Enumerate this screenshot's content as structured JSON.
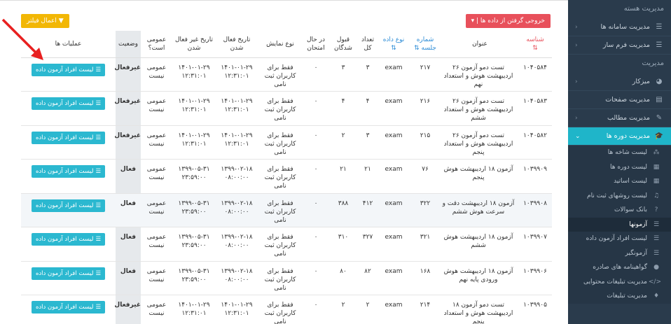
{
  "sidebar": {
    "section1": "مدیریت هسته",
    "items1": [
      {
        "label": "مدیریت سامانه ها",
        "icon": "☰"
      },
      {
        "label": "مدیریت فرم ساز",
        "icon": "☰"
      }
    ],
    "section2": "مدیریت",
    "items2": [
      {
        "label": "میزکار",
        "icon": "◕"
      },
      {
        "label": "مدیریت صفحات",
        "icon": "▤"
      },
      {
        "label": "مدیریت مطالب",
        "icon": "✎"
      },
      {
        "label": "مدیریت دوره ها",
        "icon": "🎓"
      }
    ],
    "sub": [
      {
        "label": "لیست شاخه ها",
        "icon": "⁂"
      },
      {
        "label": "لیست دوره ها",
        "icon": "▦"
      },
      {
        "label": "لیست اساتید",
        "icon": "▦"
      },
      {
        "label": "لیست روشهای ثبت نام",
        "icon": "♫"
      },
      {
        "label": "بانک سوالات",
        "icon": "?"
      },
      {
        "label": "آزمونها",
        "icon": "☰"
      },
      {
        "label": "لیست افراد آزمون داده",
        "icon": "☰"
      },
      {
        "label": "آزمونگیر",
        "icon": "☰"
      },
      {
        "label": "گواهینامه های صادره",
        "icon": "●"
      },
      {
        "label": "مدیریت تبلیغات محتوایی",
        "icon": "</>"
      },
      {
        "label": "مدیریت تبلیغات",
        "icon": "♦"
      }
    ]
  },
  "toolbar": {
    "export_label": "خروجی گرفتن از داده ها | ▾",
    "filter_label": "▼ اعمال فیلتر"
  },
  "table": {
    "headers": {
      "id": "شناسه",
      "title": "عنوان",
      "session": "شماره جلسه",
      "type": "نوع داده",
      "total": "تعداد کل",
      "accepted": "قبول شدگان",
      "exam": "در حال امتحان",
      "display": "نوع نمایش",
      "active_date": "تاریخ فعال شدن",
      "inactive_date": "تاریخ غیر فعال شدن",
      "public": "عمومی است؟",
      "status": "وضعیت",
      "ops": "عملیات ها"
    },
    "button_label": "لیست افراد آزمون داده",
    "rows": [
      {
        "id": "۱۰۴۰۵۸۴",
        "title": "تست دمو آزمون ۲۶ اردیبهشت هوش و استعداد نهم",
        "session": "۲۱۷",
        "type": "exam",
        "total": "۳",
        "accepted": "۳",
        "exam": "۰",
        "display": "فقط برای کاربران ثبت نامی",
        "active": "۱۴۰۱-۰۱-۲۹ ۱۲:۳۱:۰۱",
        "inactive": "۱۴۰۱-۰۱-۲۹ ۱۲:۳۱:۰۱",
        "public": "عمومی نیست",
        "status": "غیرفعال"
      },
      {
        "id": "۱۰۴۰۵۸۳",
        "title": "تست دمو آزمون ۲۶ اردیبهشت هوش و استعداد ششم",
        "session": "۲۱۶",
        "type": "exam",
        "total": "۴",
        "accepted": "۴",
        "exam": "۰",
        "display": "فقط برای کاربران ثبت نامی",
        "active": "۱۴۰۱-۰۱-۲۹ ۱۲:۳۱:۰۱",
        "inactive": "۱۴۰۱-۰۱-۲۹ ۱۲:۳۱:۰۱",
        "public": "عمومی نیست",
        "status": "غیرفعال"
      },
      {
        "id": "۱۰۴۰۵۸۲",
        "title": "تست دمو آزمون ۲۶ اردیبهشت هوش و استعداد پنجم",
        "session": "۲۱۵",
        "type": "exam",
        "total": "۳",
        "accepted": "۲",
        "exam": "۰",
        "display": "فقط برای کاربران ثبت نامی",
        "active": "۱۴۰۱-۰۱-۲۹ ۱۲:۳۱:۰۱",
        "inactive": "۱۴۰۱-۰۱-۲۹ ۱۲:۳۱:۰۱",
        "public": "عمومی نیست",
        "status": "غیرفعال"
      },
      {
        "id": "۱۰۳۹۹۰۹",
        "title": "آزمون ۱۸ اردیبهشت هوش پنجم",
        "session": "۷۶",
        "type": "exam",
        "total": "۲۱",
        "accepted": "۲۱",
        "exam": "۰",
        "display": "فقط برای کاربران ثبت نامی",
        "active": "۱۳۹۹-۰۲-۱۸ ۰۸:۰۰:۰۰",
        "inactive": "۱۳۹۹-۰۵-۳۱ ۲۳:۵۹:۰۰",
        "public": "عمومی نیست",
        "status": "فعال"
      },
      {
        "id": "۱۰۳۹۹۰۸",
        "title": "آزمون ۱۸ اردیبهشت دقت و سرعت هوش ششم",
        "session": "۳۲۲",
        "type": "exam",
        "total": "۴۱۲",
        "accepted": "۳۸۸",
        "exam": "۰",
        "display": "فقط برای کاربران ثبت نامی",
        "active": "۱۳۹۹-۰۲-۱۸ ۰۸:۰۰:۰۰",
        "inactive": "۱۳۹۹-۰۵-۳۱ ۲۳:۵۹:۰۰",
        "public": "عمومی نیست",
        "status": "فعال"
      },
      {
        "id": "۱۰۳۹۹۰۷",
        "title": "آزمون ۱۸ اردیبهشت هوش ششم",
        "session": "۳۲۱",
        "type": "exam",
        "total": "۳۲۷",
        "accepted": "۳۱۰",
        "exam": "۰",
        "display": "فقط برای کاربران ثبت نامی",
        "active": "۱۳۹۹-۰۲-۱۸ ۰۸:۰۰:۰۰",
        "inactive": "۱۳۹۹-۰۵-۳۱ ۲۳:۵۹:۰۰",
        "public": "عمومی نیست",
        "status": "فعال"
      },
      {
        "id": "۱۰۳۹۹۰۶",
        "title": "آزمون ۱۸ اردیبهشت هوش ورودی پایه نهم",
        "session": "۱۶۸",
        "type": "exam",
        "total": "۸۲",
        "accepted": "۸۰",
        "exam": "۰",
        "display": "فقط برای کاربران ثبت نامی",
        "active": "۱۳۹۹-۰۲-۱۸ ۰۸:۰۰:۰۰",
        "inactive": "۱۳۹۹-۰۵-۳۱ ۲۳:۵۹:۰۰",
        "public": "عمومی نیست",
        "status": "فعال"
      },
      {
        "id": "۱۰۳۹۹۰۵",
        "title": "تست دمو آزمون ۱۸ اردیبهشت هوش و استعداد پنجم",
        "session": "۲۱۴",
        "type": "exam",
        "total": "۲",
        "accepted": "۲",
        "exam": "۰",
        "display": "فقط برای کاربران ثبت نامی",
        "active": "۱۴۰۱-۰۱-۲۹ ۱۲:۳۱:۰۱",
        "inactive": "۱۴۰۱-۰۱-۲۹ ۱۲:۳۱:۰۱",
        "public": "عمومی نیست",
        "status": "غیرفعال"
      }
    ]
  },
  "colors": {
    "sidebar_bg": "#2a3b4c",
    "accent": "#1fb5c9",
    "export_btn": "#e8505b",
    "filter_btn": "#f2b705",
    "arrow": "#e82020"
  }
}
